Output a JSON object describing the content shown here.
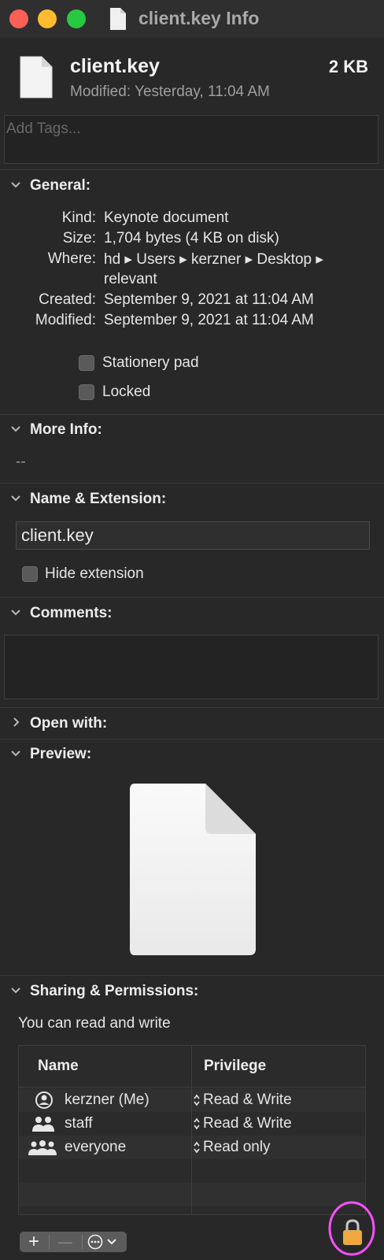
{
  "window": {
    "title": "client.key Info"
  },
  "header": {
    "name": "client.key",
    "size": "2 KB",
    "modified": "Modified: Yesterday, 11:04 AM"
  },
  "tags": {
    "placeholder": "Add Tags..."
  },
  "general": {
    "title": "General:",
    "rows": [
      {
        "label": "Kind:",
        "value": "Keynote document"
      },
      {
        "label": "Size:",
        "value": "1,704 bytes (4 KB on disk)"
      },
      {
        "label": "Where:",
        "value": "hd ▸ Users ▸ kerzner ▸ Desktop ▸",
        "value2": "relevant"
      },
      {
        "label": "Created:",
        "value": "September 9, 2021 at 11:04 AM"
      },
      {
        "label": "Modified:",
        "value": "September 9, 2021 at 11:04 AM"
      }
    ],
    "stationery_label": "Stationery pad",
    "locked_label": "Locked"
  },
  "more_info": {
    "title": "More Info:",
    "value": "--"
  },
  "name_ext": {
    "title": "Name & Extension:",
    "value": "client.key",
    "hide_label": "Hide extension"
  },
  "comments": {
    "title": "Comments:"
  },
  "open_with": {
    "title": "Open with:"
  },
  "preview": {
    "title": "Preview:"
  },
  "sharing": {
    "title": "Sharing & Permissions:",
    "status": "You can read and write",
    "columns": {
      "name": "Name",
      "privilege": "Privilege"
    },
    "rows": [
      {
        "name": "kerzner (Me)",
        "privilege": "Read & Write",
        "icon": "user-icon"
      },
      {
        "name": "staff",
        "privilege": "Read & Write",
        "icon": "group-icon"
      },
      {
        "name": "everyone",
        "privilege": "Read only",
        "icon": "everyone-icon"
      }
    ],
    "add_symbol": "+",
    "remove_symbol": "—"
  },
  "colors": {
    "lock": "#f0a641",
    "highlight": "#ff4fff",
    "close": "#ff5f57",
    "minimize": "#febc2e",
    "zoom": "#28c840"
  }
}
